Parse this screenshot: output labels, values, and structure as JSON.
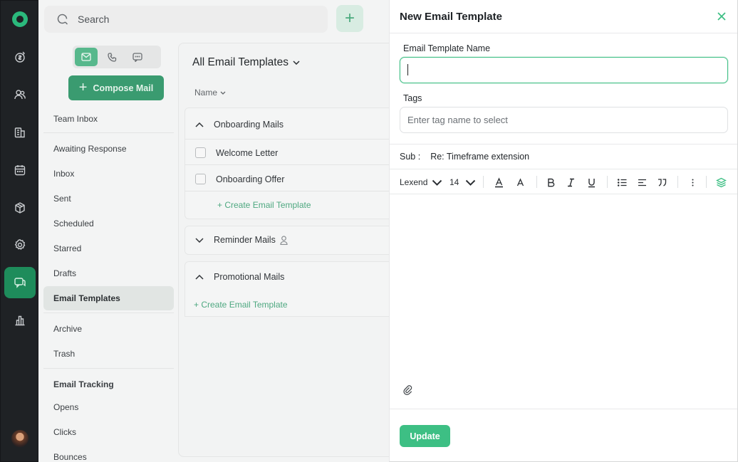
{
  "colors": {
    "accent": "#3dbf84",
    "rail_bg": "#1f2225",
    "overlay_bg": "#f3f4f4"
  },
  "search": {
    "label": "Search"
  },
  "sidebar": {
    "compose_label": "Compose Mail",
    "items": [
      {
        "label": "Team Inbox"
      },
      {
        "label": "Awaiting Response"
      },
      {
        "label": "Inbox"
      },
      {
        "label": "Sent"
      },
      {
        "label": "Scheduled"
      },
      {
        "label": "Starred"
      },
      {
        "label": "Drafts"
      },
      {
        "label": "Email Templates"
      },
      {
        "label": "Archive"
      },
      {
        "label": "Trash"
      },
      {
        "label": "Email Tracking"
      },
      {
        "label": "Opens"
      },
      {
        "label": "Clicks"
      },
      {
        "label": "Bounces"
      }
    ]
  },
  "templates": {
    "title": "All Email Templates",
    "column_name": "Name",
    "groups": [
      {
        "name": "Onboarding Mails",
        "items": [
          "Welcome Letter",
          "Onboarding Offer"
        ],
        "create_label": "+ Create Email Template"
      },
      {
        "name": "Reminder Mails"
      },
      {
        "name": "Promotional Mails",
        "create_label": "+ Create Email Template"
      }
    ]
  },
  "modal": {
    "title": "New Email Template",
    "name_label": "Email Template Name",
    "name_value": "",
    "tags_label": "Tags",
    "tags_placeholder": "Enter tag name to select",
    "sub_label": "Sub :",
    "sub_value": "Re: Timeframe extension",
    "font_family": "Lexend",
    "font_size": "14",
    "update_label": "Update"
  }
}
